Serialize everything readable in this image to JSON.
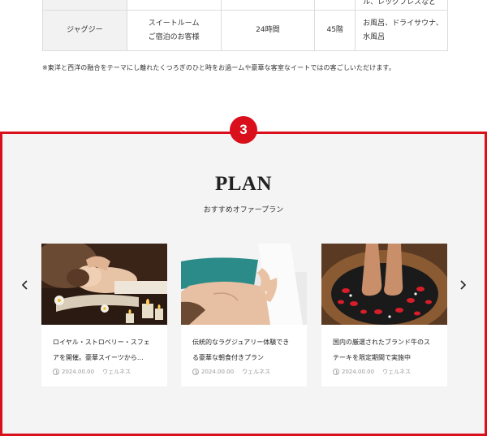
{
  "table": {
    "rows": [
      {
        "cells": [
          "",
          "",
          "",
          "",
          "ル、レッグプレスなど"
        ]
      },
      {
        "cells": [
          "ジャグジー",
          [
            "スイートルーム",
            "ご宿泊のお客様"
          ],
          "24時間",
          "45階",
          [
            "お風呂、ドライサウナ、",
            "水風呂"
          ]
        ]
      }
    ]
  },
  "note": "※東洋と西洋の融合をテーマにし離れたくつろぎのひと時をお過ームや豪華な客室なイートではの客ごしいただけます。",
  "section": {
    "badge": "3",
    "title": "PLAN",
    "subtitle": "おすすめオファープラン",
    "cards": [
      {
        "title": [
          "ロイヤル・ストロベリー・スフェ",
          "アを開催。豪華スイーツから…"
        ],
        "date": "2024.00.00",
        "category": "ウェルネス",
        "image": "facial-massage-photo"
      },
      {
        "title": [
          "伝統的なラグジュアリー体験でき",
          "る豪華な朝食付きプラン"
        ],
        "date": "2024.00.00",
        "category": "ウェルネス",
        "image": "back-massage-photo"
      },
      {
        "title": [
          "国内の厳選されたブランド牛のス",
          "テーキを限定期間で実施中"
        ],
        "date": "2024.00.00",
        "category": "ウェルネス",
        "image": "foot-spa-photo"
      }
    ],
    "prev_icon": "chevron-left-icon",
    "next_icon": "chevron-right-icon"
  },
  "colors": {
    "accent": "#d9101b",
    "section_bg": "#f4f4f4",
    "meta": "#999999"
  }
}
